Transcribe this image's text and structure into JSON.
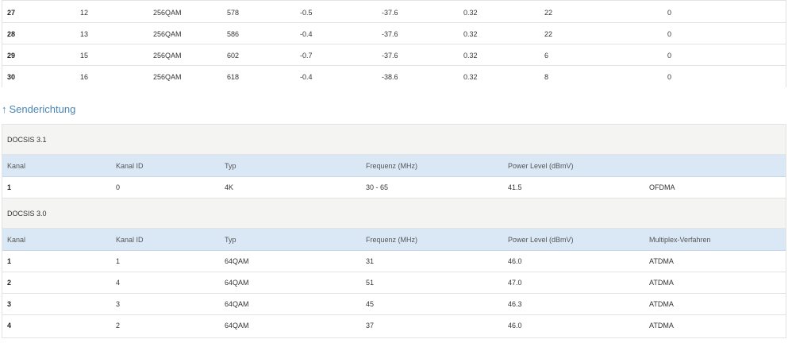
{
  "downstream_rows": [
    [
      "27",
      "12",
      "256QAM",
      "578",
      "-0.5",
      "-37.6",
      "0.32",
      "22",
      "0"
    ],
    [
      "28",
      "13",
      "256QAM",
      "586",
      "-0.4",
      "-37.6",
      "0.32",
      "22",
      "0"
    ],
    [
      "29",
      "15",
      "256QAM",
      "602",
      "-0.7",
      "-37.6",
      "0.32",
      "6",
      "0"
    ],
    [
      "30",
      "16",
      "256QAM",
      "618",
      "-0.4",
      "-38.6",
      "0.32",
      "8",
      "0"
    ]
  ],
  "upstream": {
    "title": "Senderichtung",
    "arrow_icon": "arrow-up-icon",
    "docsis31": {
      "label": "DOCSIS 3.1",
      "headers": [
        "Kanal",
        "Kanal ID",
        "Typ",
        "Frequenz (MHz)",
        "Power Level (dBmV)",
        ""
      ],
      "rows": [
        [
          "1",
          "0",
          "4K",
          "30 - 65",
          "41.5",
          "OFDMA"
        ]
      ]
    },
    "docsis30": {
      "label": "DOCSIS 3.0",
      "headers": [
        "Kanal",
        "Kanal ID",
        "Typ",
        "Frequenz (MHz)",
        "Power Level (dBmV)",
        "Multiplex-Verfahren"
      ],
      "rows": [
        [
          "1",
          "1",
          "64QAM",
          "31",
          "46.0",
          "ATDMA"
        ],
        [
          "2",
          "4",
          "64QAM",
          "51",
          "47.0",
          "ATDMA"
        ],
        [
          "3",
          "3",
          "64QAM",
          "45",
          "46.3",
          "ATDMA"
        ],
        [
          "4",
          "2",
          "64QAM",
          "37",
          "46.0",
          "ATDMA"
        ]
      ]
    }
  }
}
